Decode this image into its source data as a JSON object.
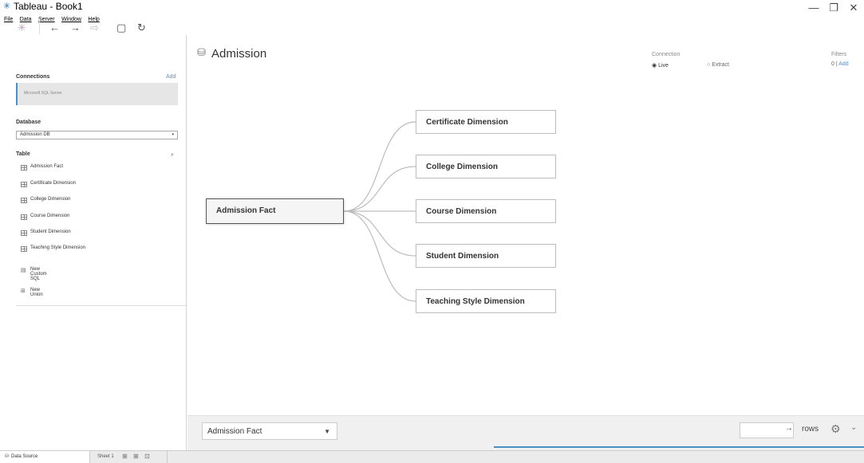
{
  "window": {
    "title": "Tableau - Book1",
    "minimize": "—",
    "restore": "❐",
    "close": "✕"
  },
  "menu": [
    "File",
    "Data",
    "Server",
    "Window",
    "Help"
  ],
  "toolbar": {
    "logo": "✳",
    "back": "←",
    "forward": "→",
    "redo_disabled": "⇨",
    "save": "▢",
    "refresh": "↻"
  },
  "sidebar": {
    "connections_title": "Connections",
    "connections_add": "Add",
    "connection_name": "Microsoft SQL Server",
    "database_title": "Database",
    "database_value": "Admission DB",
    "table_title": "Table",
    "tables": [
      "Admission Fact",
      "Certificate Dimension",
      "College Dimension",
      "Course Dimension",
      "Student Dimension",
      "Teaching Style Dimension"
    ],
    "new_custom_sql": "New Custom SQL",
    "new_union": "New Union"
  },
  "canvas": {
    "datasource_title": "Admission",
    "connection_label": "Connection",
    "live_label": "Live",
    "extract_label": "Extract",
    "filters_label": "Filters",
    "filters_count": "0",
    "filters_add": "Add",
    "fact_table": "Admission Fact",
    "dimensions": [
      "Certificate Dimension",
      "College Dimension",
      "Course Dimension",
      "Student Dimension",
      "Teaching Style Dimension"
    ]
  },
  "bottom": {
    "selected_table": "Admission Fact",
    "rows_label": "rows"
  },
  "tabs": {
    "data_source": "Data Source",
    "sheet1": "Sheet 1"
  },
  "colors": {
    "accent": "#4a8fc3",
    "link": "#5b8fc7"
  }
}
